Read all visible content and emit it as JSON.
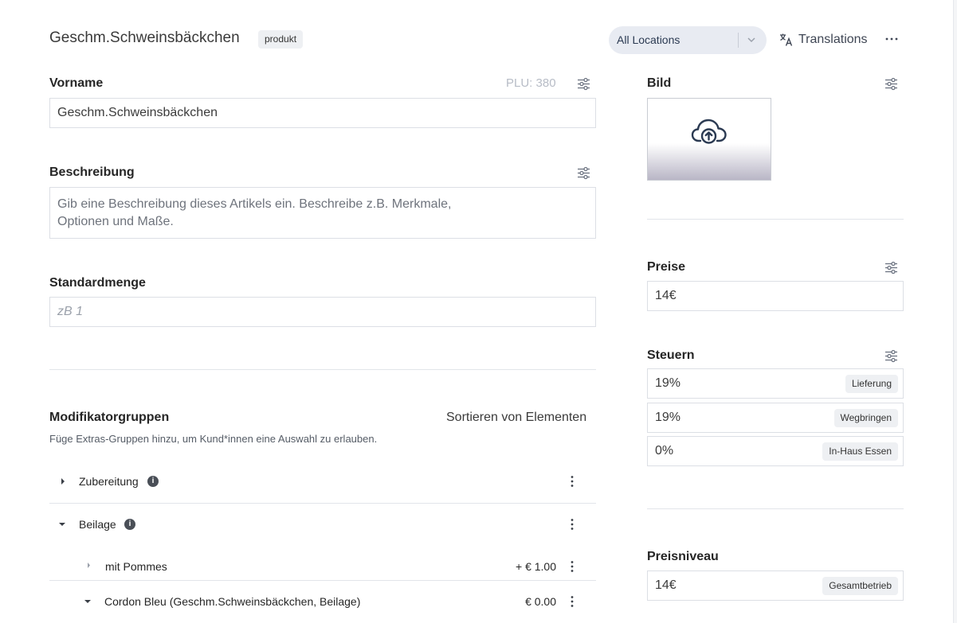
{
  "header": {
    "title": "Geschm.Schweinsbäckchen",
    "badge": "produkt",
    "location_select": "All Locations",
    "translations_label": "Translations"
  },
  "form": {
    "name_label": "Vorname",
    "plu": "PLU: 380",
    "name_value": "Geschm.Schweinsbäckchen",
    "description_label": "Beschreibung",
    "description_placeholder_line1": "Gib eine Beschreibung dieses Artikels ein. Beschreibe z.B. Merkmale,",
    "description_placeholder_line2": "Optionen und Maße.",
    "default_qty_label": "Standardmenge",
    "default_qty_placeholder": "zB 1"
  },
  "modifiers": {
    "title": "Modifikatorgruppen",
    "sort_label": "Sortieren von Elementen",
    "subtitle": "Füge Extras-Gruppen hinzu, um Kund*innen eine Auswahl zu erlauben.",
    "groups": [
      {
        "name": "Zubereitung",
        "expanded": false
      },
      {
        "name": "Beilage",
        "expanded": true
      }
    ],
    "items": [
      {
        "name": "mit Pommes",
        "price": "+ € 1.00",
        "expanded": false
      },
      {
        "name": "Cordon Bleu (Geschm.Schweinsbäckchen, Beilage)",
        "price": "€ 0.00",
        "expanded": true
      }
    ]
  },
  "right": {
    "image_label": "Bild",
    "prices_label": "Preise",
    "price_value": "14€",
    "taxes_label": "Steuern",
    "taxes": [
      {
        "value": "19%",
        "tag": "Lieferung"
      },
      {
        "value": "19%",
        "tag": "Wegbringen"
      },
      {
        "value": "0%",
        "tag": "In-Haus Essen"
      }
    ],
    "price_level_label": "Preisniveau",
    "price_level_value": "14€",
    "price_level_tag": "Gesamtbetrieb"
  },
  "icons": {
    "adjust": "sliders-icon",
    "upload": "cloud-upload-icon",
    "translate": "translate-icon",
    "more": "more-horizontal-icon",
    "kebab": "more-vertical-icon",
    "info": "info-icon",
    "caret_right": "caret-right-icon",
    "caret_down": "caret-down-icon"
  },
  "colors": {
    "accent_pill": "#e8ebf2",
    "border": "#dcdfe5",
    "badge_bg": "#eef0f3"
  }
}
